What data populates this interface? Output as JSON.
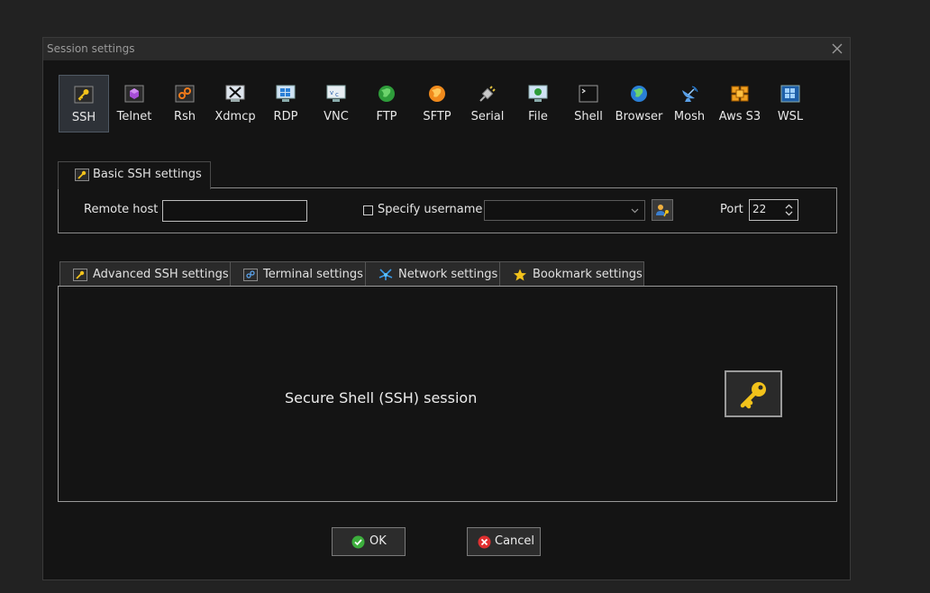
{
  "dialog": {
    "title": "Session settings"
  },
  "session_types": [
    {
      "label": "SSH",
      "icon": "key-icon",
      "selected": true
    },
    {
      "label": "Telnet",
      "icon": "telnet-icon"
    },
    {
      "label": "Rsh",
      "icon": "rsh-icon"
    },
    {
      "label": "Xdmcp",
      "icon": "x-display-icon"
    },
    {
      "label": "RDP",
      "icon": "remote-desktop-icon"
    },
    {
      "label": "VNC",
      "icon": "vnc-icon"
    },
    {
      "label": "FTP",
      "icon": "green-globe-icon"
    },
    {
      "label": "SFTP",
      "icon": "orange-globe-icon"
    },
    {
      "label": "Serial",
      "icon": "serial-plug-icon"
    },
    {
      "label": "File",
      "icon": "file-monitor-icon"
    },
    {
      "label": "Shell",
      "icon": "terminal-icon"
    },
    {
      "label": "Browser",
      "icon": "browser-globe-icon"
    },
    {
      "label": "Mosh",
      "icon": "satellite-dish-icon"
    },
    {
      "label": "Aws S3",
      "icon": "aws-cubes-icon"
    },
    {
      "label": "WSL",
      "icon": "windows-icon"
    }
  ],
  "basic": {
    "tab_label": "Basic SSH settings",
    "remote_host_label": "Remote host *",
    "remote_host_value": "",
    "specify_username_label": "Specify username",
    "username_value": "",
    "port_label": "Port",
    "port_value": "22"
  },
  "tabs": [
    {
      "label": "Advanced SSH settings",
      "icon": "key-icon"
    },
    {
      "label": "Terminal settings",
      "icon": "terminal-settings-icon"
    },
    {
      "label": "Network settings",
      "icon": "network-icon"
    },
    {
      "label": "Bookmark settings",
      "icon": "star-icon"
    }
  ],
  "main": {
    "description": "Secure Shell (SSH) session"
  },
  "buttons": {
    "ok_label": "OK",
    "cancel_label": "Cancel"
  },
  "colors": {
    "ok_green": "#3cae3c",
    "cancel_red": "#e03030",
    "key_gold": "#f2c21b"
  }
}
